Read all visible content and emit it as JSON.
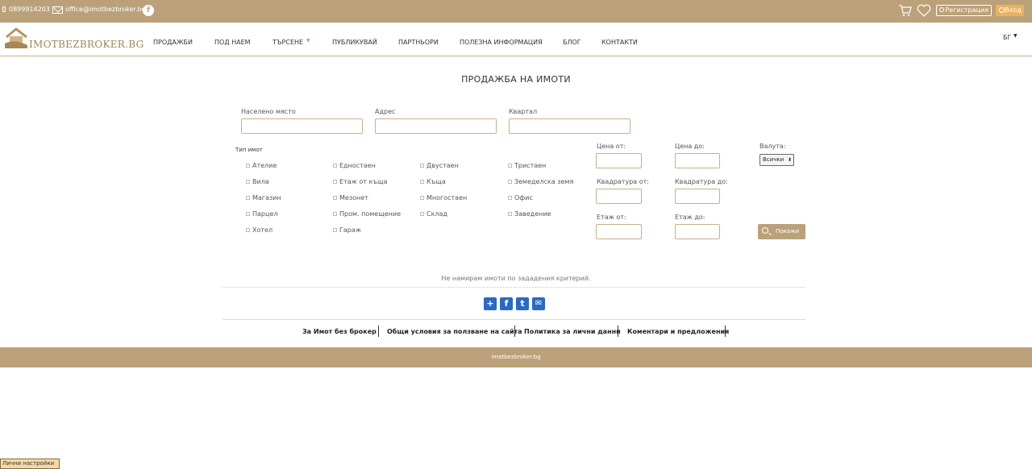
{
  "topbar": {
    "phone": "0899914203",
    "email": "office@imotbezbroker.bg",
    "facebook_icon": "f",
    "register_label": "Регистрация",
    "login_label": "Вход"
  },
  "nav": {
    "logo_text": "IMOTBEZBROKER.BG",
    "items": [
      "ПРОДАЖБИ",
      "ПОД НАЕМ",
      "ТЪРСЕНЕ",
      "ПУБЛИКУВАЙ",
      "ПАРТНЬОРИ",
      "ПОЛЕЗНА ИНФОРМАЦИЯ",
      "БЛОГ",
      "КОНТАКТИ"
    ],
    "language": "БГ",
    "caret": "▼"
  },
  "page": {
    "title": "ПРОДАЖБА НА ИМОТИ"
  },
  "search": {
    "location_label": "Населено място",
    "location_value": "",
    "address_label": "Адрес",
    "address_value": "",
    "district_label": "Квартал",
    "district_value": "",
    "type_label": "Тип имот",
    "types": [
      [
        "Ателие",
        "Едностаен",
        "Двустаен",
        "Тристаен"
      ],
      [
        "Вила",
        "Етаж от къща",
        "Къща",
        "Земеделска земя"
      ],
      [
        "Магазин",
        "Мезонет",
        "Многостаен",
        "Офис"
      ],
      [
        "Парцел",
        "Пром. помещение",
        "Склад",
        "Заведение"
      ],
      [
        "Хотел",
        "Гараж"
      ]
    ],
    "price_from_label": "Цена от:",
    "price_to_label": "Цена до:",
    "currency_label": "Валута:",
    "currency_value": "Всички",
    "area_from_label": "Квадратура от:",
    "area_to_label": "Квадратура до:",
    "floor_from_label": "Етаж от:",
    "floor_to_label": "Етаж до:",
    "show_button": "Покажи"
  },
  "results": {
    "empty_text": "Не намирам имоти по зададения критерий."
  },
  "share": [
    "+",
    "f",
    "t",
    "✉"
  ],
  "footer": {
    "links": [
      "За Имот без брокер",
      "Общи условия за ползване на сайта",
      "Политика за лични данни",
      "Коментари и предложения"
    ],
    "site": "imotbezbroker.bg"
  },
  "settings_tab": "Лични настройки"
}
